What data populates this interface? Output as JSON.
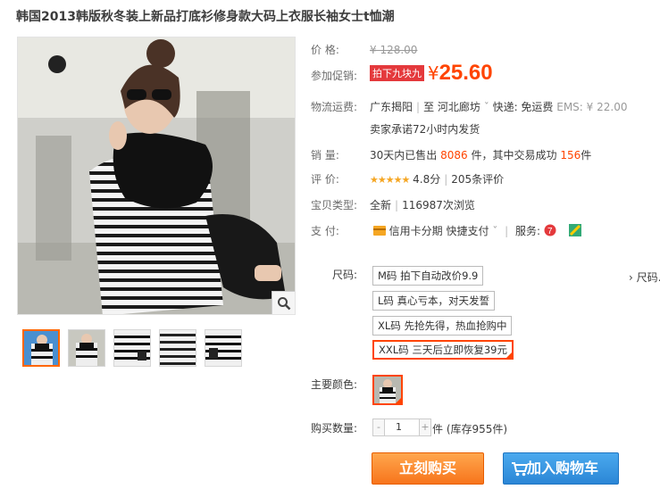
{
  "title": "韩国2013韩版秋冬装上新品打底衫修身款大码上衣服长袖女士t恤潮",
  "price": {
    "label": "价    格:",
    "original": "¥ 128.00",
    "promo_label": "参加促销:",
    "promo_badge": "拍下九块九",
    "yen": "¥",
    "current": "25.60"
  },
  "shipping": {
    "label": "物流运费:",
    "origin": "广东揭阳",
    "to_word": "至",
    "destination": "河北廊坊",
    "express": "快递: 免运费",
    "ems": "EMS: ¥ 22.00",
    "promise": "卖家承诺72小时内发货"
  },
  "sales": {
    "label": "销    量:",
    "prefix": "30天内已售出",
    "count": "8086",
    "mid": "件，其中交易成功",
    "success": "156",
    "suffix": "件"
  },
  "rating": {
    "label": "评    价:",
    "stars": "★★★★★",
    "score": "4.8分",
    "reviews": "205条评价"
  },
  "item_type": {
    "label": "宝贝类型:",
    "value": "全新",
    "views": "116987次浏览"
  },
  "payment": {
    "label": "支    付:",
    "credit": "信用卡分期",
    "quick": "快捷支付",
    "service": "服务:"
  },
  "sku": {
    "label": "尺码:",
    "more": "› 尺码.",
    "options": [
      "M码 拍下自动改价9.9",
      "L码 真心亏本，对天发誓",
      "XL码 先抢先得，热血抢购中",
      "XXL码 三天后立即恢复39元"
    ],
    "selected_index": 3
  },
  "color": {
    "label": "主要颜色:"
  },
  "quantity": {
    "label": "购买数量:",
    "minus": "-",
    "value": "1",
    "plus": "+",
    "stock": "件 (库存955件)"
  },
  "buttons": {
    "buy_now": "立刻购买",
    "add_cart": "加入购物车"
  },
  "colors": {
    "accent": "#ff4400",
    "buy_orange": "#f7751c",
    "cart_blue": "#2b86d6"
  }
}
